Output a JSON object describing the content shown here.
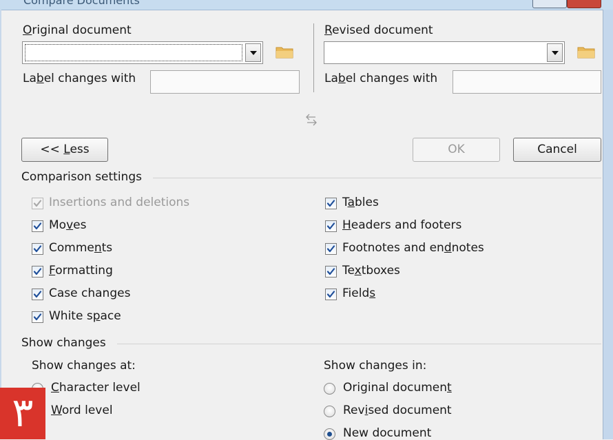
{
  "window": {
    "title": "Compare Documents"
  },
  "original": {
    "label_pre": "",
    "label_ul": "O",
    "label_post": "riginal document",
    "value": "",
    "label_changes_pre": "La",
    "label_changes_ul": "b",
    "label_changes_post": "el changes with",
    "label_changes_value": ""
  },
  "revised": {
    "label_pre": "",
    "label_ul": "R",
    "label_post": "evised document",
    "value": "",
    "label_changes_pre": "La",
    "label_changes_ul": "b",
    "label_changes_post": "el changes with",
    "label_changes_value": ""
  },
  "swap_icon": "swap-arrows-icon",
  "buttons": {
    "less_pre": "<< ",
    "less_ul": "L",
    "less_post": "ess",
    "ok": "OK",
    "cancel": "Cancel"
  },
  "comparison_settings": {
    "heading": "Comparison settings",
    "left": [
      {
        "pre": "Insertions and deletions",
        "ul": "",
        "post": "",
        "checked": true,
        "disabled": true
      },
      {
        "pre": "Mo",
        "ul": "v",
        "post": "es",
        "checked": true,
        "disabled": false
      },
      {
        "pre": "Comme",
        "ul": "n",
        "post": "ts",
        "checked": true,
        "disabled": false
      },
      {
        "pre": "",
        "ul": "F",
        "post": "ormatting",
        "checked": true,
        "disabled": false
      },
      {
        "pre": "Case chan",
        "ul": "g",
        "post": "es",
        "checked": true,
        "disabled": false
      },
      {
        "pre": "White s",
        "ul": "p",
        "post": "ace",
        "checked": true,
        "disabled": false
      }
    ],
    "right": [
      {
        "pre": "T",
        "ul": "a",
        "post": "bles",
        "checked": true
      },
      {
        "pre": "",
        "ul": "H",
        "post": "eaders and footers",
        "checked": true
      },
      {
        "pre": "Footnotes and en",
        "ul": "d",
        "post": "notes",
        "checked": true
      },
      {
        "pre": "Te",
        "ul": "x",
        "post": "tboxes",
        "checked": true
      },
      {
        "pre": "Field",
        "ul": "s",
        "post": "",
        "checked": true
      }
    ]
  },
  "show_changes": {
    "heading": "Show changes",
    "at_label": "Show changes at:",
    "at_options": [
      {
        "pre": "",
        "ul": "C",
        "post": "haracter level",
        "selected": false
      },
      {
        "pre": "",
        "ul": "W",
        "post": "ord level",
        "selected": true
      }
    ],
    "in_label": "Show changes in:",
    "in_options": [
      {
        "pre": "Original documen",
        "ul": "t",
        "post": "",
        "selected": false
      },
      {
        "pre": "Rev",
        "ul": "i",
        "post": "sed document",
        "selected": false
      },
      {
        "pre": "New document",
        "ul": "",
        "post": "",
        "selected": true
      }
    ]
  },
  "badge": {
    "text": "٣",
    "color": "#d9342b"
  },
  "colors": {
    "check": "#1f4f9a",
    "check_disabled": "#a9a9a9",
    "folder": "#e9b95a"
  }
}
